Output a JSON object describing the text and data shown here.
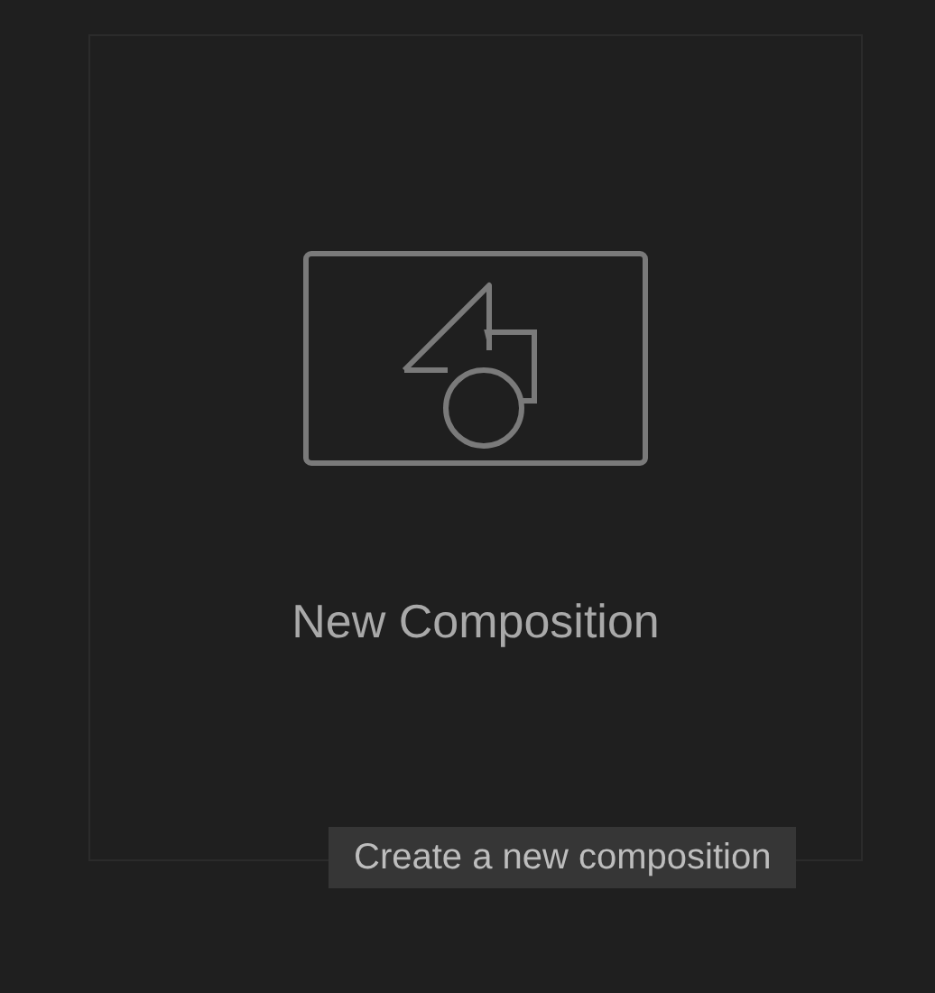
{
  "card": {
    "label": "New Composition"
  },
  "tooltip": {
    "text": "Create a new composition"
  }
}
